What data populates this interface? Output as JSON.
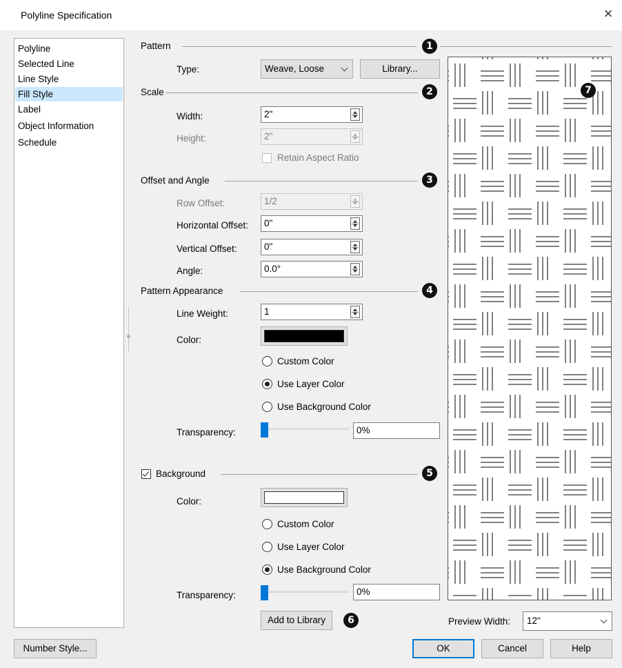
{
  "window": {
    "title": "Polyline Specification",
    "close_glyph": "×"
  },
  "sidebar": {
    "items": [
      {
        "label": "Polyline"
      },
      {
        "label": "Selected Line"
      },
      {
        "label": "Line Style"
      },
      {
        "label": "Fill Style",
        "selected": true
      },
      {
        "label": "Label"
      },
      {
        "label": "Object Information"
      },
      {
        "label": "Schedule"
      }
    ]
  },
  "pattern": {
    "header": "Pattern",
    "type_label": "Type:",
    "type_value": "Weave, Loose",
    "library_button": "Library..."
  },
  "scale": {
    "header": "Scale",
    "width_label": "Width:",
    "width_value": "2\"",
    "height_label": "Height:",
    "height_value": "2\"",
    "retain_aspect_label": "Retain Aspect Ratio"
  },
  "offset": {
    "header": "Offset and Angle",
    "row_offset_label": "Row Offset:",
    "row_offset_value": "1/2",
    "horizontal_label": "Horizontal Offset:",
    "horizontal_value": "0\"",
    "vertical_label": "Vertical Offset:",
    "vertical_value": "0\"",
    "angle_label": "Angle:",
    "angle_value": "0.0°"
  },
  "appearance": {
    "header": "Pattern Appearance",
    "line_weight_label": "Line Weight:",
    "line_weight_value": "1",
    "color_label": "Color:",
    "color_value": "#000000",
    "radio_custom": "Custom Color",
    "radio_layer": "Use Layer Color",
    "radio_background": "Use Background Color",
    "selected_option": "Use Layer Color",
    "transparency_label": "Transparency:",
    "transparency_value": "0%"
  },
  "background": {
    "checkbox_label": "Background",
    "checked": true,
    "color_label": "Color:",
    "color_value": "#ffffff",
    "radio_custom": "Custom Color",
    "radio_layer": "Use Layer Color",
    "radio_background": "Use Background Color",
    "selected_option": "Use Background Color",
    "transparency_label": "Transparency:",
    "transparency_value": "0%",
    "add_library_button": "Add to Library"
  },
  "preview": {
    "width_label": "Preview Width:",
    "width_value": "12\""
  },
  "callouts": [
    "1",
    "2",
    "3",
    "4",
    "5",
    "6",
    "7"
  ],
  "footer": {
    "number_style_button": "Number Style...",
    "ok_button": "OK",
    "cancel_button": "Cancel",
    "help_button": "Help"
  },
  "colors": {
    "selection": "#cce8ff",
    "accent": "#0078d7"
  }
}
